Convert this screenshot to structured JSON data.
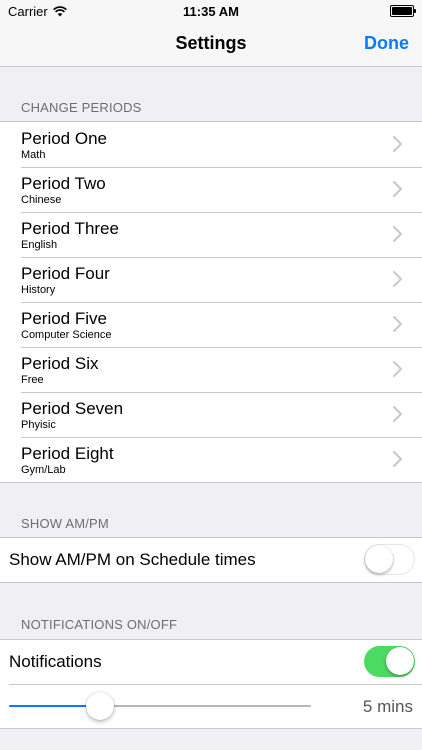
{
  "status_bar": {
    "carrier": "Carrier",
    "time": "11:35 AM"
  },
  "nav": {
    "title": "Settings",
    "done_label": "Done"
  },
  "periods": {
    "header": "CHANGE PERIODS",
    "items": [
      {
        "label": "Period One",
        "subject": "Math"
      },
      {
        "label": "Period Two",
        "subject": "Chinese"
      },
      {
        "label": "Period Three",
        "subject": "English"
      },
      {
        "label": "Period Four",
        "subject": "History"
      },
      {
        "label": "Period Five",
        "subject": "Computer Science"
      },
      {
        "label": "Period Six",
        "subject": "Free"
      },
      {
        "label": "Period Seven",
        "subject": "Phyisic"
      },
      {
        "label": "Period Eight",
        "subject": "Gym/Lab"
      }
    ]
  },
  "ampm": {
    "header": "SHOW AM/PM",
    "label": "Show AM/PM on Schedule times",
    "enabled": false
  },
  "notifications": {
    "header": "NOTIFICATIONS ON/OFF",
    "label": "Notifications",
    "enabled": true,
    "slider_fraction": 0.3,
    "slider_value_label": "5 mins"
  },
  "colors": {
    "accent": "#0a7aff",
    "switch_on": "#4cd964",
    "background": "#efeff4"
  }
}
